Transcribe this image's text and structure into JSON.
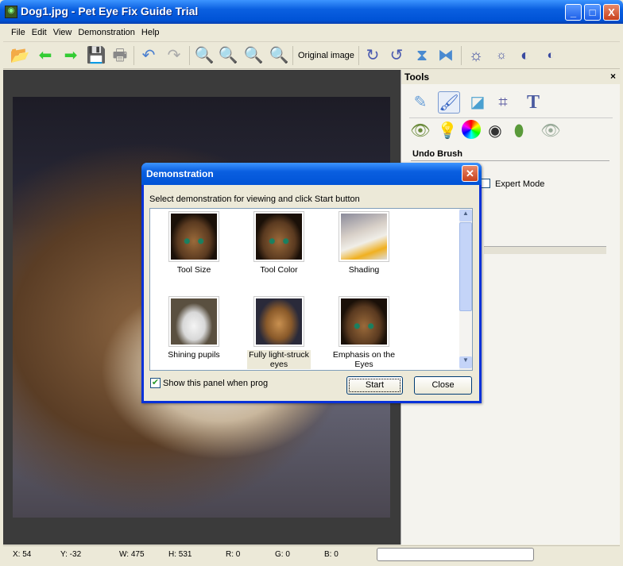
{
  "window": {
    "title": "Dog1.jpg - Pet Eye Fix Guide Trial",
    "minimize": "_",
    "maximize": "□",
    "close": "X"
  },
  "menu": [
    "File",
    "Edit",
    "View",
    "Demonstration",
    "Help"
  ],
  "toolbar": {
    "original_image_label": "Original image"
  },
  "tools_panel": {
    "title": "Tools",
    "close": "×",
    "section": "Undo Brush",
    "expert_mode": "Expert Mode"
  },
  "dialog": {
    "title": "Demonstration",
    "close": "✕",
    "instruction": "Select demonstration for viewing and click Start button",
    "items": [
      {
        "label": "Tool Size"
      },
      {
        "label": "Tool Color"
      },
      {
        "label": "Shading"
      },
      {
        "label": "Shining pupils"
      },
      {
        "label": "Fully light-struck eyes",
        "selected": true
      },
      {
        "label": "Emphasis on the Eyes"
      }
    ],
    "show_panel_label": "Show this panel when prog",
    "show_panel_checked": true,
    "start": "Start",
    "close_button": "Close"
  },
  "status": {
    "x": "X: 54",
    "y": "Y: -32",
    "w": "W: 475",
    "h": "H: 531",
    "r": "R: 0",
    "g": "G: 0",
    "b": "B: 0"
  }
}
